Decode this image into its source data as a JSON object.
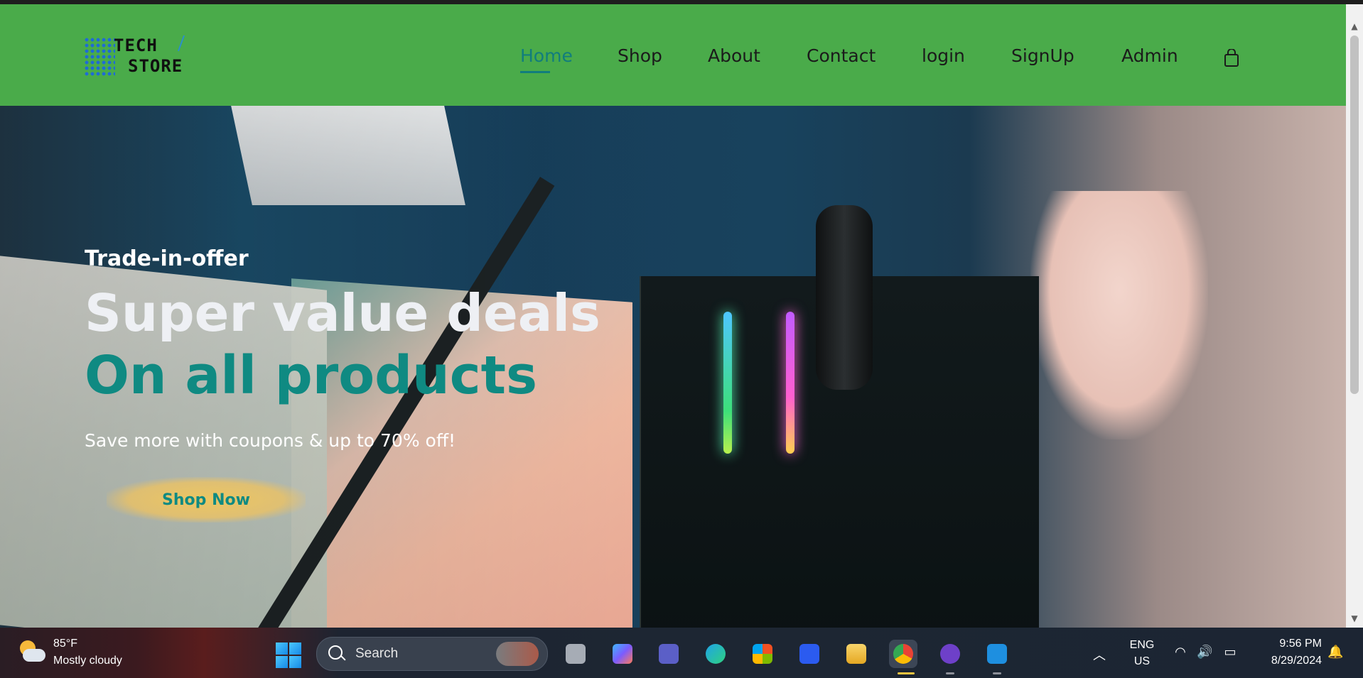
{
  "window": {
    "title": "TECH STORE"
  },
  "header": {
    "logo": {
      "line1": "TECH",
      "line2": "STORE"
    },
    "nav": [
      {
        "label": "Home",
        "active": true
      },
      {
        "label": "Shop",
        "active": false
      },
      {
        "label": "About",
        "active": false
      },
      {
        "label": "Contact",
        "active": false
      },
      {
        "label": "login",
        "active": false
      },
      {
        "label": "SignUp",
        "active": false
      },
      {
        "label": "Admin",
        "active": false
      }
    ],
    "cart_icon": "shopping-bag-icon"
  },
  "hero": {
    "kicker": "Trade-in-offer",
    "headline": "Super value deals",
    "headline_accent": "On all products",
    "subtext": "Save more with coupons & up to 70% off!",
    "cta_label": "Shop Now"
  },
  "taskbar": {
    "weather": {
      "temp": "85°F",
      "condition": "Mostly cloudy"
    },
    "search_label": "Search",
    "apps": [
      {
        "name": "task-view",
        "color": "#c9ced6"
      },
      {
        "name": "copilot",
        "color": "#7b5cff"
      },
      {
        "name": "teams",
        "color": "#5b5fc7"
      },
      {
        "name": "edge",
        "color": "#1fa3e8"
      },
      {
        "name": "microsoft-store",
        "color": "#f25022"
      },
      {
        "name": "powerautomate",
        "color": "#2b5bf0"
      },
      {
        "name": "file-explorer",
        "color": "#f4c542"
      },
      {
        "name": "chrome",
        "color": "#34a853"
      },
      {
        "name": "github-desktop",
        "color": "#6e40c9"
      },
      {
        "name": "vscode",
        "color": "#1e8fe0"
      }
    ],
    "language": {
      "line1": "ENG",
      "line2": "US"
    },
    "time": "9:56 PM",
    "date": "8/29/2024"
  },
  "colors": {
    "header_bg": "#4aab4a",
    "accent": "#0f8a82",
    "cta_bg": "#f2c35f"
  }
}
